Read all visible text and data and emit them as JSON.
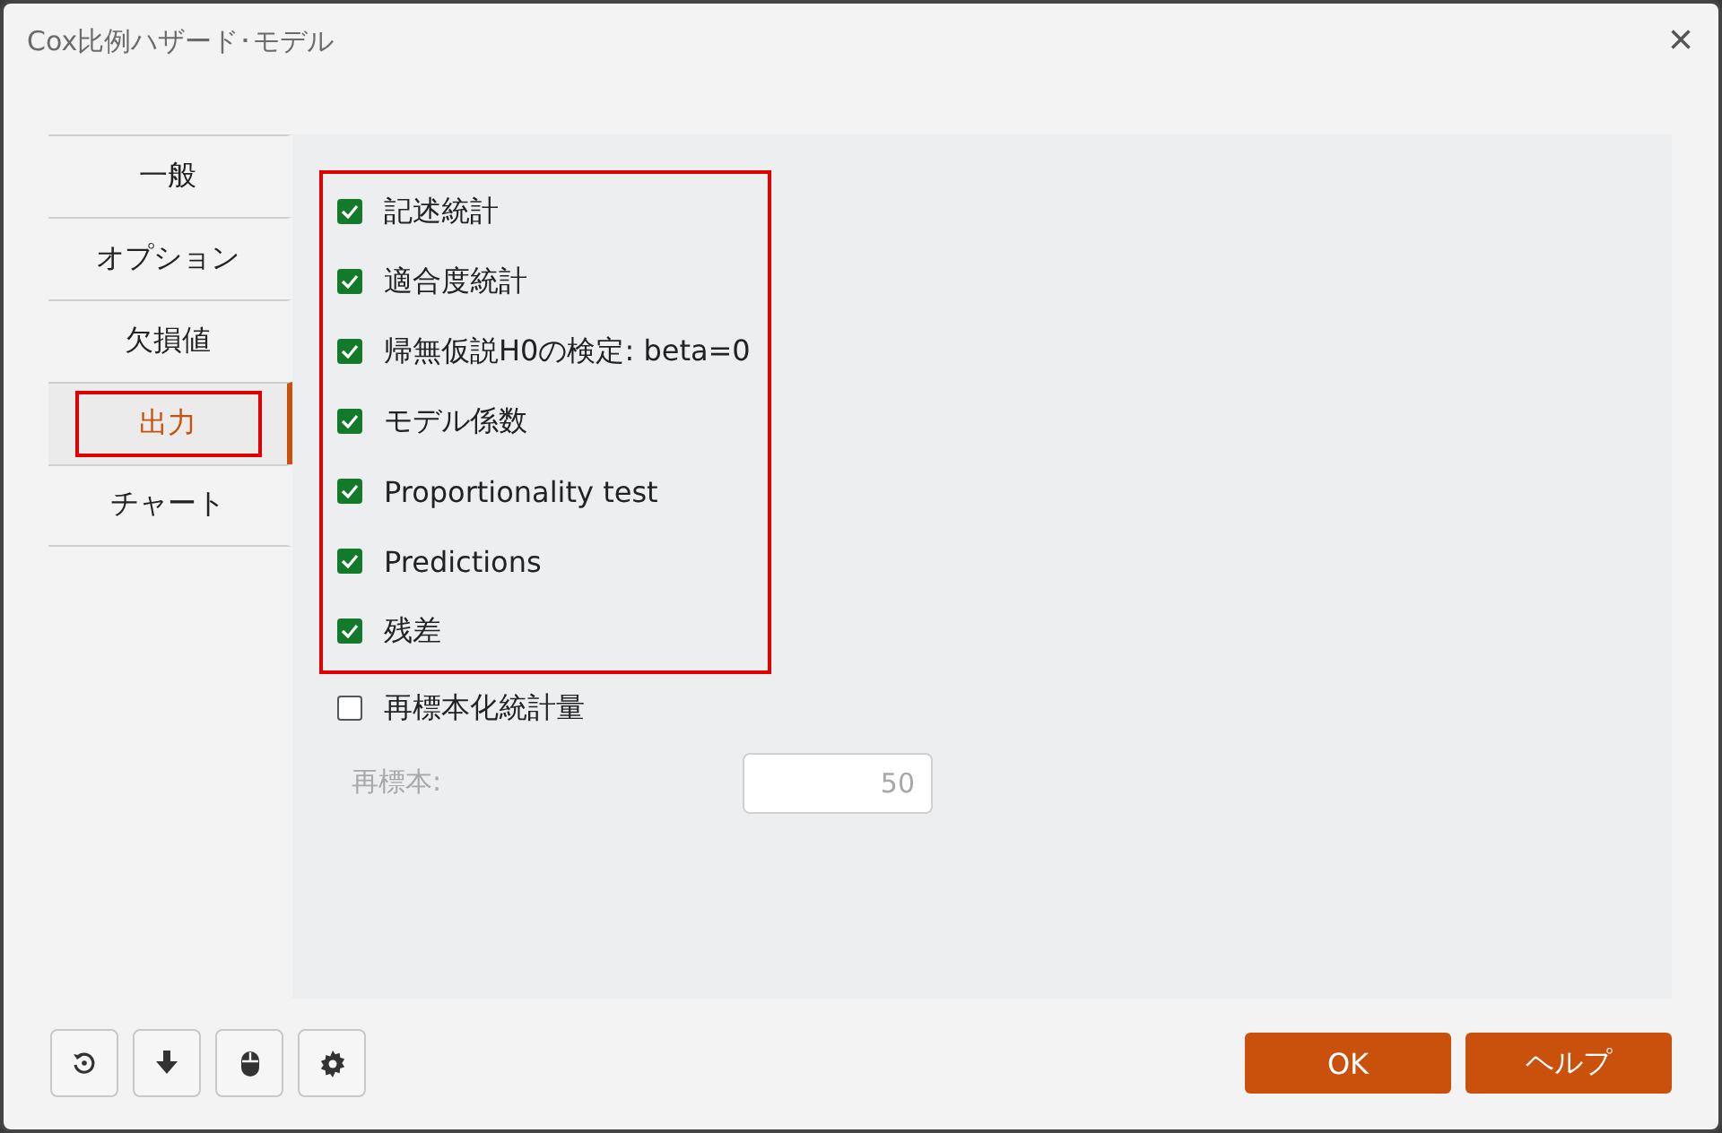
{
  "window": {
    "title": "Cox比例ハザード･モデル",
    "close": "×"
  },
  "tabs": [
    {
      "label": "一般",
      "selected": false,
      "highlighted": false
    },
    {
      "label": "オプション",
      "selected": false,
      "highlighted": false
    },
    {
      "label": "欠損値",
      "selected": false,
      "highlighted": false
    },
    {
      "label": "出力",
      "selected": true,
      "highlighted": true
    },
    {
      "label": "チャート",
      "selected": false,
      "highlighted": false
    }
  ],
  "output_options": {
    "highlighted": true,
    "items": [
      {
        "label": "記述統計",
        "checked": true
      },
      {
        "label": "適合度統計",
        "checked": true
      },
      {
        "label": "帰無仮説H0の検定: beta=0",
        "checked": true
      },
      {
        "label": "モデル係数",
        "checked": true
      },
      {
        "label": "Proportionality test",
        "checked": true
      },
      {
        "label": "Predictions",
        "checked": true
      },
      {
        "label": "残差",
        "checked": true
      }
    ]
  },
  "resampling": {
    "label": "再標本化統計量",
    "checked": false,
    "field": {
      "label": "再標本:",
      "value": "50",
      "disabled": true
    }
  },
  "tool_buttons": [
    {
      "kind": "reset"
    },
    {
      "kind": "download"
    },
    {
      "kind": "mouse"
    },
    {
      "kind": "settings"
    }
  ],
  "buttons": [
    {
      "label": "OK"
    },
    {
      "label": "ヘルプ"
    }
  ]
}
